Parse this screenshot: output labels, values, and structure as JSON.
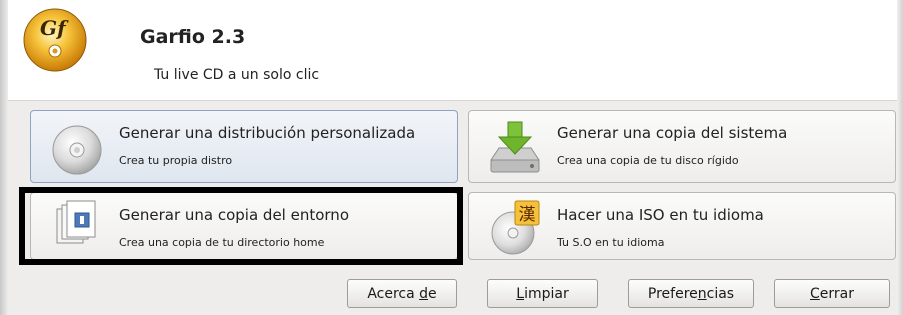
{
  "app": {
    "title": "Garfio 2.3",
    "subtitle": "Tu live CD a un solo clic",
    "logo_text": "Gf"
  },
  "options": [
    {
      "title": "Generar una distribución personalizada",
      "description": "Crea tu propia distro",
      "icon": "cd-disc-icon"
    },
    {
      "title": "Generar una copia del sistema",
      "description": "Crea una copia de tu disco rígido",
      "icon": "hard-drive-download-icon"
    },
    {
      "title": "Generar una copia del entorno",
      "description": "Crea una copia de tu directorio home",
      "icon": "documents-stack-icon"
    },
    {
      "title": "Hacer una ISO en tu idioma",
      "description": "Tu S.O en tu idioma",
      "icon": "language-cd-icon",
      "glyph": "漢"
    }
  ],
  "buttons": {
    "about": {
      "pre": "Acerca ",
      "key": "d",
      "post": "e"
    },
    "clear": {
      "pre": "",
      "key": "L",
      "post": "impiar"
    },
    "prefs": {
      "pre": "Prefere",
      "key": "n",
      "post": "cias"
    },
    "close": {
      "pre": "",
      "key": "C",
      "post": "errar"
    }
  },
  "colors": {
    "panel": "#eeedeb",
    "active_option": "#dfe6ef",
    "focus_border": "#000000",
    "download_arrow": "#6fb52c",
    "logo_gold": "#e8a20a"
  }
}
